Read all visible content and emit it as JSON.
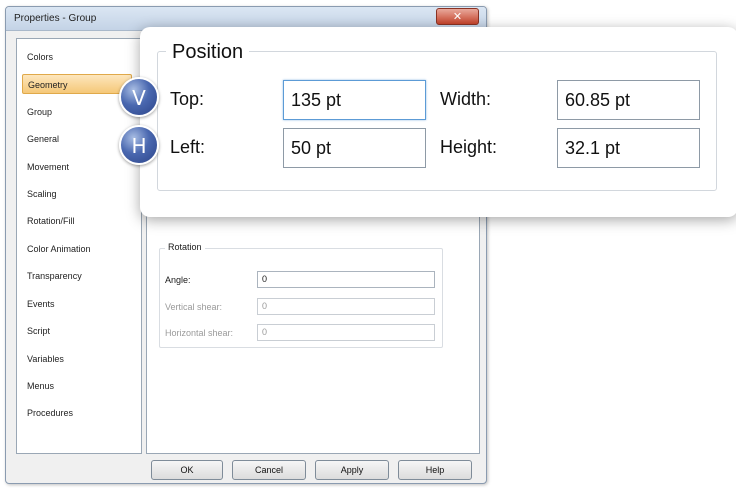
{
  "window": {
    "title": "Properties - Group",
    "close_glyph": "✕"
  },
  "sidebar": {
    "items": [
      {
        "label": "Colors"
      },
      {
        "label": "Geometry",
        "selected": true
      },
      {
        "label": "Group"
      },
      {
        "label": "General"
      },
      {
        "label": "Movement"
      },
      {
        "label": "Scaling"
      },
      {
        "label": "Rotation/Fill"
      },
      {
        "label": "Color Animation"
      },
      {
        "label": "Transparency"
      },
      {
        "label": "Events"
      },
      {
        "label": "Script"
      },
      {
        "label": "Variables"
      },
      {
        "label": "Menus"
      },
      {
        "label": "Procedures"
      }
    ]
  },
  "rotation": {
    "group_title": "Rotation",
    "angle_label": "Angle:",
    "angle_value": "0",
    "vshear_label": "Vertical shear:",
    "vshear_value": "0",
    "hshear_label": "Horizontal shear:",
    "hshear_value": "0"
  },
  "buttons": {
    "ok": "OK",
    "cancel": "Cancel",
    "apply": "Apply",
    "help": "Help"
  },
  "position": {
    "group_title": "Position",
    "top_label": "Top:",
    "top_value": "135 pt",
    "left_label": "Left:",
    "left_value": "50 pt",
    "width_label": "Width:",
    "width_value": "60.85 pt",
    "height_label": "Height:",
    "height_value": "32.1 pt"
  },
  "markers": {
    "vertical": "V",
    "horizontal": "H"
  },
  "colors": {
    "selection": "#f5c878",
    "marker": "#4a68b0",
    "close_button": "#c7442c"
  }
}
